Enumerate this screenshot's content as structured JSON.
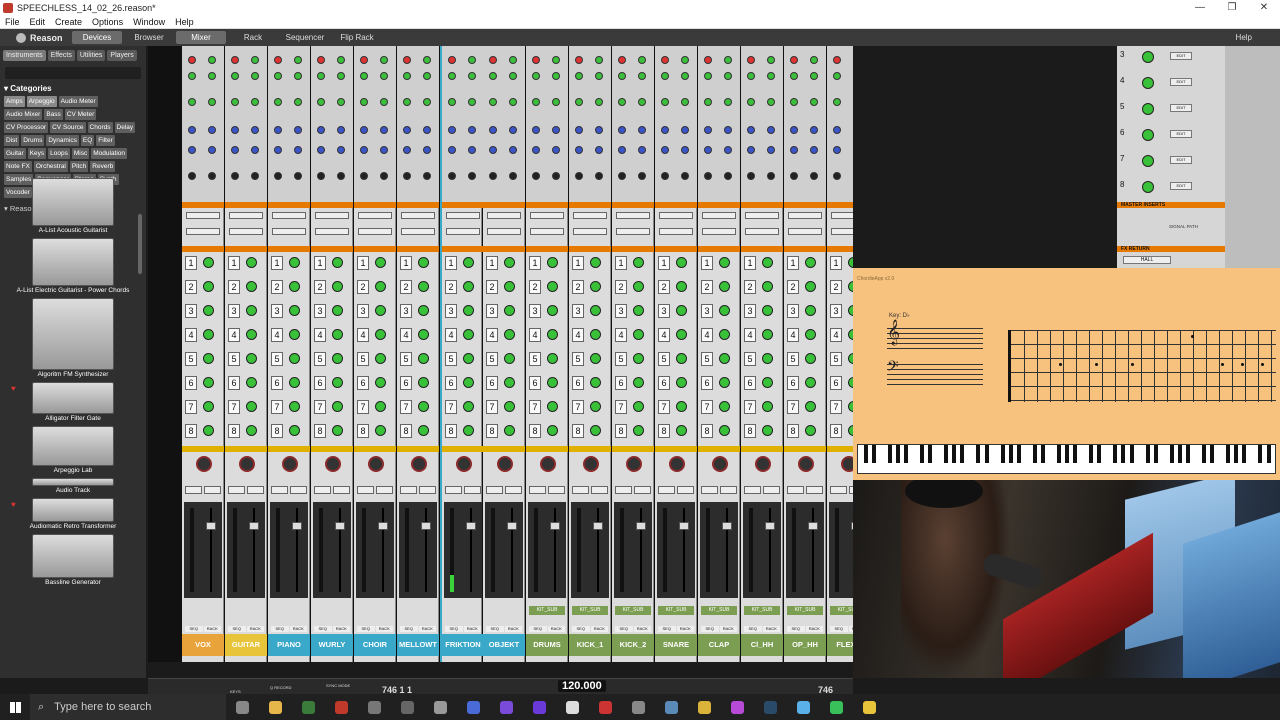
{
  "window": {
    "title": "SPEECHLESS_14_02_26.reason*",
    "min": "—",
    "restore": "❐",
    "close": "✕"
  },
  "menu": [
    "File",
    "Edit",
    "Create",
    "Options",
    "Window",
    "Help"
  ],
  "topnav": {
    "logo": "Reason",
    "tabs": [
      "Devices",
      "Browser",
      "Mixer",
      "Rack",
      "Sequencer",
      "Flip Rack"
    ],
    "active_tab": "Mixer",
    "help": "Help"
  },
  "sidebar": {
    "tabs": [
      "Instruments",
      "Effects",
      "Utilities",
      "Players"
    ],
    "categories_label": "Categories",
    "categories": [
      "Amps",
      "Arpeggio",
      "Audio Meter",
      "Audio Mixer",
      "Bass",
      "CV Meter",
      "CV Processor",
      "CV Source",
      "Chords",
      "Delay",
      "Dist",
      "Drums",
      "Dynamics",
      "EQ",
      "Filter",
      "Guitar",
      "Keys",
      "Loops",
      "Misc",
      "Modulation",
      "Note FX",
      "Orchestral",
      "Pitch",
      "Reverb",
      "Samples",
      "Sequencer",
      "Stereo",
      "Synth",
      "Vocoder"
    ],
    "section": "Reason Studios",
    "devices": [
      "A-List Acoustic Guitarist",
      "A-List Electric Guitarist - Power Chords",
      "Algoritm FM Synthesizer",
      "Alligator Filter Gate",
      "Arpeggio Lab",
      "Audio Track",
      "Audiomatic Retro Transformer",
      "Bassline Generator"
    ]
  },
  "mixer": {
    "labels": {
      "inserts": "INSERTS",
      "bypass": "BYPASS",
      "edit_inserts": "EDIT INSERTS",
      "send": "SEND",
      "fader": "FADER",
      "mute": "MUTE",
      "solo": "SOLO",
      "seq": "SEQ",
      "rack": "RACK",
      "output": "OUTPUT",
      "kit_sub": "KIT_SUB"
    },
    "channels": [
      {
        "name": "VOX",
        "color": "#e8a33a",
        "meter": 0.0
      },
      {
        "name": "GUITAR",
        "color": "#e8c43a",
        "meter": 0.0
      },
      {
        "name": "PIANO",
        "color": "#3aa8c8",
        "meter": 0.0
      },
      {
        "name": "WURLY",
        "color": "#3aa8c8",
        "meter": 0.0
      },
      {
        "name": "CHOIR",
        "color": "#3aa8c8",
        "meter": 0.0
      },
      {
        "name": "MELLOWT RON",
        "color": "#3aa8c8",
        "meter": 0.0
      },
      {
        "name": "FRIKTION",
        "color": "#3aa8c8",
        "meter": 0.2
      },
      {
        "name": "OBJEKT",
        "color": "#3aa8c8",
        "meter": 0.0
      },
      {
        "name": "DRUMS",
        "color": "#7c9e52",
        "meter": 0.0
      },
      {
        "name": "KICK_1",
        "color": "#7c9e52",
        "meter": 0.0
      },
      {
        "name": "KICK_2",
        "color": "#7c9e52",
        "meter": 0.0
      },
      {
        "name": "SNARE",
        "color": "#7c9e52",
        "meter": 0.0
      },
      {
        "name": "CLAP",
        "color": "#7c9e52",
        "meter": 0.0
      },
      {
        "name": "Cl_HH",
        "color": "#7c9e52",
        "meter": 0.0
      },
      {
        "name": "OP_HH",
        "color": "#7c9e52",
        "meter": 0.0
      },
      {
        "name": "FLEX_",
        "color": "#7c9e52",
        "meter": 0.0
      }
    ],
    "master": {
      "inserts_label": "MASTER INSERTS",
      "signal_path": "SIGNAL PATH",
      "fx_return": "FX RETURN",
      "reverb": "HALL",
      "edit": "EDIT",
      "level": "LEVEL",
      "rows": [
        "3",
        "4",
        "5",
        "6",
        "7",
        "8"
      ]
    }
  },
  "chord_app": {
    "title": "ChordieApp v2.0",
    "key": "Key: D♭"
  },
  "transport": {
    "keys": "KEYS",
    "q_record": "Q RECORD",
    "sync_mode": "SYNC MODE",
    "position": "746  1  1",
    "tempo": "120.000",
    "right_pos": "746"
  },
  "taskbar": {
    "search_placeholder": "Type here to search"
  }
}
